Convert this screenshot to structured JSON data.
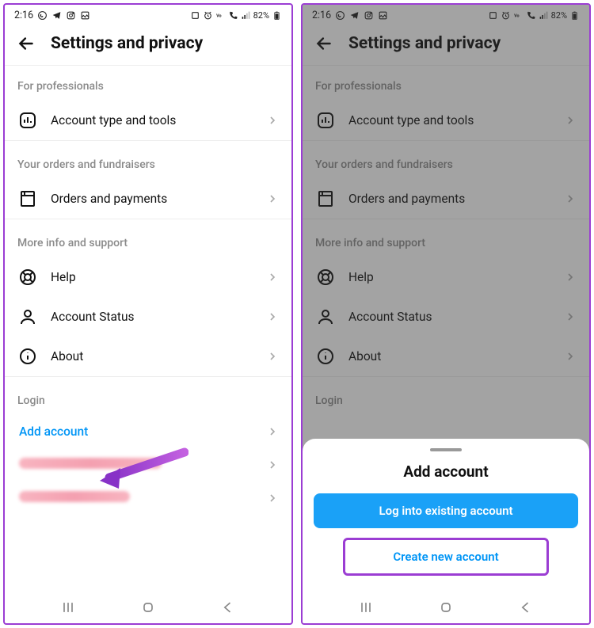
{
  "statusbar": {
    "time": "2:16",
    "battery": "82%"
  },
  "appbar": {
    "title": "Settings and privacy"
  },
  "sections": {
    "professionals": {
      "header": "For professionals",
      "item0": {
        "label": "Account type and tools"
      }
    },
    "orders": {
      "header": "Your orders and fundraisers",
      "item0": {
        "label": "Orders and payments"
      }
    },
    "info": {
      "header": "More info and support",
      "item0": {
        "label": "Help"
      },
      "item1": {
        "label": "Account Status"
      },
      "item2": {
        "label": "About"
      }
    },
    "login": {
      "header": "Login",
      "add": "Add account"
    }
  },
  "sheet": {
    "title": "Add account",
    "primary": "Log into existing account",
    "secondary": "Create new account"
  }
}
